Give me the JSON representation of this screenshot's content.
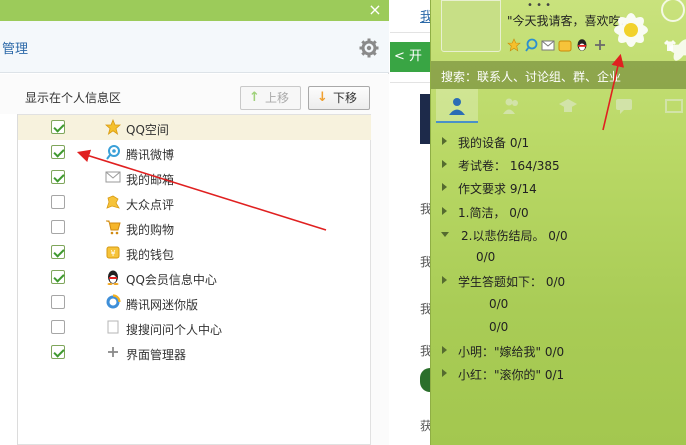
{
  "dialog": {
    "title": "管理",
    "close_glyph": "×",
    "section_label": "显示在个人信息区",
    "btn_up": "上移",
    "btn_down": "下移",
    "items": [
      {
        "label": "QQ空间",
        "checked": true,
        "icon": "star-icon",
        "selected": true
      },
      {
        "label": "腾讯微博",
        "checked": true,
        "icon": "weibo-icon",
        "selected": false
      },
      {
        "label": "我的邮箱",
        "checked": true,
        "icon": "mail-icon",
        "selected": false
      },
      {
        "label": "大众点评",
        "checked": false,
        "icon": "dianping-icon",
        "selected": false
      },
      {
        "label": "我的购物",
        "checked": false,
        "icon": "cart-icon",
        "selected": false
      },
      {
        "label": "我的钱包",
        "checked": true,
        "icon": "wallet-icon",
        "selected": false
      },
      {
        "label": "QQ会员信息中心",
        "checked": true,
        "icon": "qq-penguin-icon",
        "selected": false
      },
      {
        "label": "腾讯网迷你版",
        "checked": false,
        "icon": "globe-icon",
        "selected": false
      },
      {
        "label": "搜搜问问个人中心",
        "checked": false,
        "icon": "document-icon",
        "selected": false
      },
      {
        "label": "界面管理器",
        "checked": true,
        "icon": "plus-icon",
        "selected": false
      }
    ]
  },
  "web": {
    "link_fragment": "我",
    "green_button": "开",
    "frag_1": "我",
    "frag_2": "我",
    "frag_3": "我",
    "frag_4": "我",
    "frag_5": "获"
  },
  "qq": {
    "signature": "\"今天我请客，喜欢吃...",
    "search_text": "搜索：联系人、讨论组、群、企业",
    "groups": [
      {
        "label": "我的设备 0/1",
        "open": false,
        "sub": false
      },
      {
        "label": "考试卷：  164/385",
        "open": false,
        "sub": false
      },
      {
        "label": "作文要求 9/14",
        "open": false,
        "sub": false
      },
      {
        "label": "1.简洁，  0/0",
        "open": false,
        "sub": false
      },
      {
        "label": "2.以悲伤结局。  0/0",
        "open": true,
        "sub": false
      },
      {
        "label": "0/0",
        "open": false,
        "sub": true,
        "indent": 20
      },
      {
        "label": "学生答题如下：  0/0",
        "open": false,
        "sub": false
      },
      {
        "label": "0/0",
        "open": false,
        "sub": true,
        "indent": 34
      },
      {
        "label": "0/0",
        "open": false,
        "sub": true,
        "indent": 34
      },
      {
        "label": "小明：\"嫁给我\" 0/0",
        "open": false,
        "sub": false
      },
      {
        "label": "小红：\"滚你的\" 0/1",
        "open": false,
        "sub": false
      }
    ]
  },
  "colors": {
    "titlebar": "#9ccb5a",
    "qq_panel": "#b9d865",
    "arrow": "#e02020",
    "check": "#3f9a2f"
  }
}
